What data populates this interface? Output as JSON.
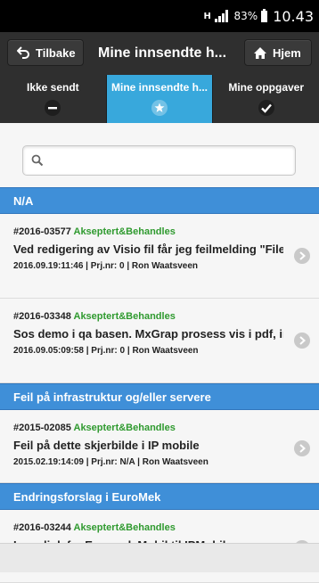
{
  "status_bar": {
    "network": "H",
    "battery_percent": "83%",
    "time": "10.43"
  },
  "header": {
    "back_label": "Tilbake",
    "title": "Mine innsendte h...",
    "home_label": "Hjem"
  },
  "tabs": [
    {
      "label": "Ikke sendt",
      "icon": "minus-icon",
      "active": false
    },
    {
      "label": "Mine innsendte h...",
      "icon": "star-icon",
      "active": true
    },
    {
      "label": "Mine oppgaver",
      "icon": "check-icon",
      "active": false
    }
  ],
  "search": {
    "placeholder": "",
    "value": ""
  },
  "sections": [
    {
      "title": "N/A",
      "items": [
        {
          "id": "#2016-03577",
          "status": "Akseptert&Behandles",
          "subject": "Ved redigering av Visio fil får jeg feilmelding \"File...",
          "meta": "2016.09.19:11:46 | Prj.nr: 0 | Ron Waatsveen"
        },
        {
          "id": "#2016-03348",
          "status": "Akseptert&Behandles",
          "subject": "Sos demo i qa basen. MxGrap prosess vis i pdf, in...",
          "meta": "2016.09.05:09:58 | Prj.nr: 0 | Ron Waatsveen"
        }
      ]
    },
    {
      "title": "Feil på infrastruktur og/eller servere",
      "items": [
        {
          "id": "#2015-02085",
          "status": "Akseptert&Behandles",
          "subject": "Feil på dette skjerbilde i IP mobile",
          "meta": "2015.02.19:14:09 | Prj.nr: N/A | Ron Waatsveen"
        }
      ]
    },
    {
      "title": "Endringsforslag i EuroMek",
      "items": [
        {
          "id": "#2016-03244",
          "status": "Akseptert&Behandles",
          "subject": "Lage link fra Euromek Mobil til IPMobile",
          "meta": ""
        }
      ]
    }
  ],
  "colors": {
    "accent": "#38a8dc",
    "divider": "#3f8fd8",
    "status_green": "#2f9a2f"
  }
}
